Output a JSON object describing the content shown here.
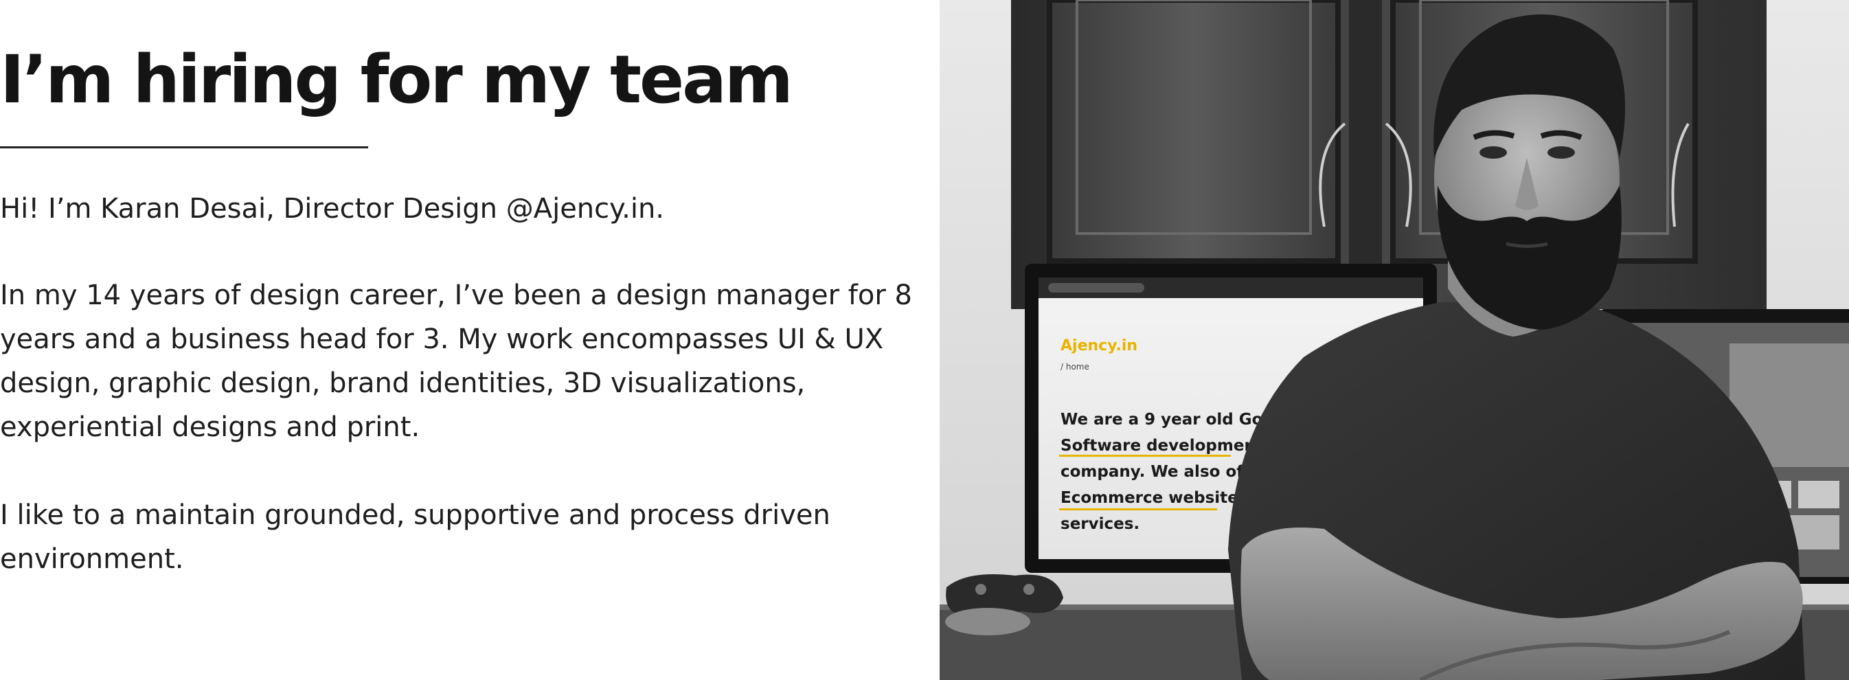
{
  "page": {
    "title": "I’m hiring for my team",
    "paragraphs": [
      "Hi! I’m Karan Desai, Director Design @Ajency.in.",
      "In my 14 years of design career, I’ve been a design manager for 8 years and a business head for 3. My work encompasses UI & UX design, graphic design, brand identities, 3D visualizations, experiential designs and print.",
      "I like to a maintain grounded, supportive and process driven environment."
    ]
  },
  "photo": {
    "monitor_text": {
      "brand": "Ajency.in",
      "nav": "/ home",
      "lines": [
        "We are a 9 year old Goa",
        "Software development",
        "company. We also off",
        "Ecommerce website",
        "services."
      ]
    },
    "colors": {
      "accent": "#e8b400",
      "text": "#141414",
      "shirt": "#2c2c2c",
      "wood": "#3b3b3b"
    }
  }
}
